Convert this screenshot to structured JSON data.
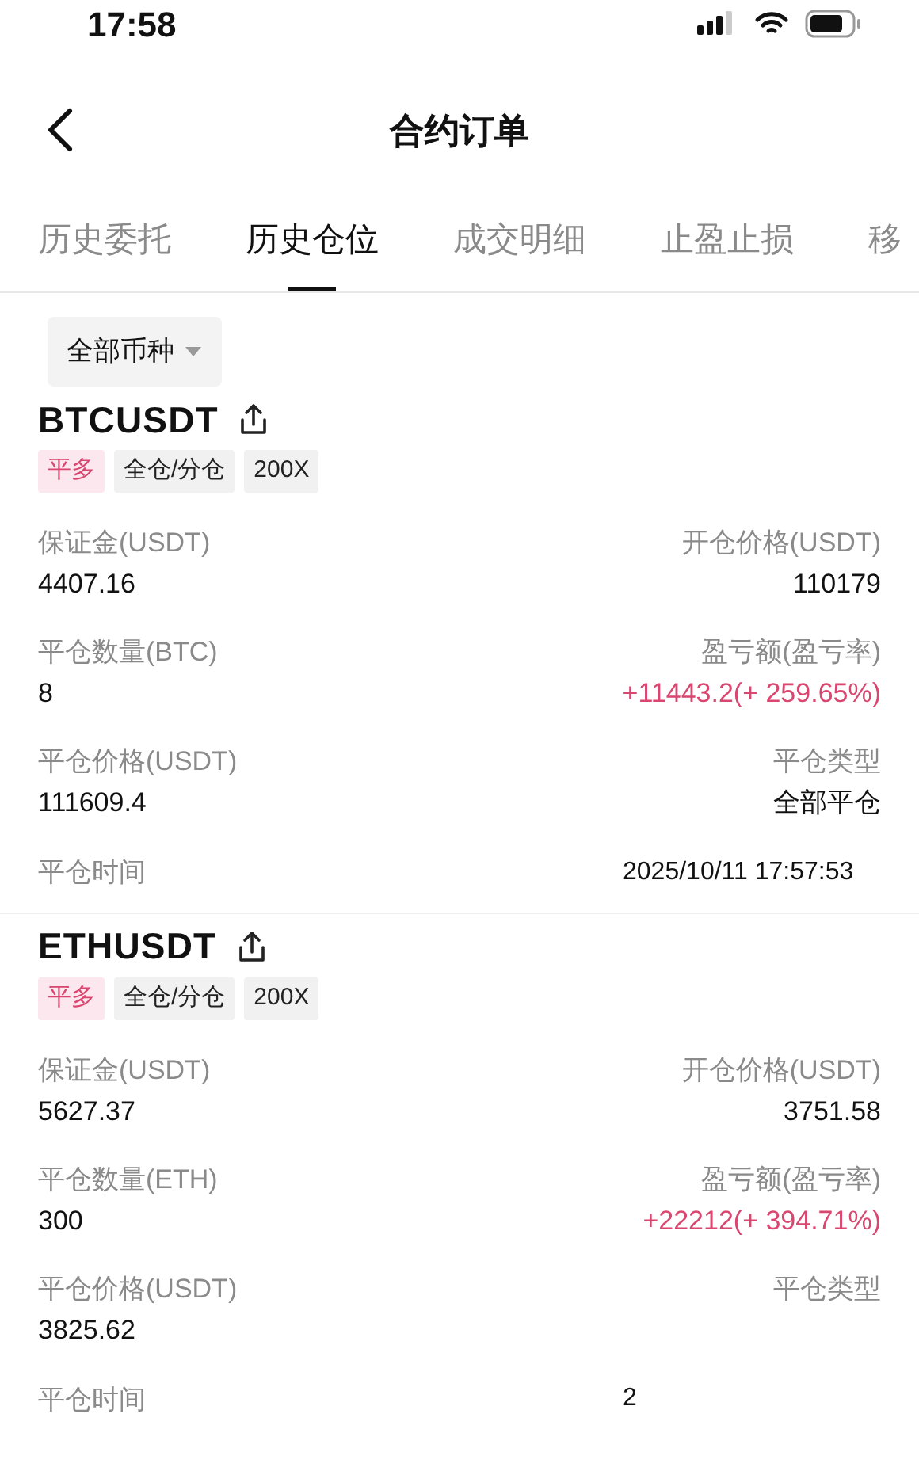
{
  "status_bar": {
    "time": "17:58"
  },
  "header": {
    "title": "合约订单"
  },
  "tabs": [
    {
      "label": "历史委托",
      "selected": false
    },
    {
      "label": "历史仓位",
      "selected": true
    },
    {
      "label": "成交明细",
      "selected": false
    },
    {
      "label": "止盈止损",
      "selected": false
    },
    {
      "label": "移",
      "selected": false
    }
  ],
  "filter": {
    "label": "全部币种"
  },
  "positions": [
    {
      "symbol": "BTCUSDT",
      "tags": [
        {
          "label": "平多",
          "kind": "side"
        },
        {
          "label": "全仓/分仓",
          "kind": "plain"
        },
        {
          "label": "200X",
          "kind": "plain"
        }
      ],
      "fields": [
        {
          "label": "保证金(USDT)",
          "value": "4407.16",
          "kind": "normal"
        },
        {
          "label": "开仓价格(USDT)",
          "value": "110179",
          "kind": "normal"
        },
        {
          "label": "平仓数量(BTC)",
          "value": "8",
          "kind": "normal"
        },
        {
          "label": "盈亏额(盈亏率)",
          "value": "+11443.2(+ 259.65%)",
          "kind": "profit"
        },
        {
          "label": "平仓价格(USDT)",
          "value": "111609.4",
          "kind": "normal"
        },
        {
          "label": "平仓类型",
          "value": "全部平仓",
          "kind": "normal"
        }
      ],
      "time_label": "平仓时间",
      "time": "2025/10/11 17:57:53"
    },
    {
      "symbol": "ETHUSDT",
      "tags": [
        {
          "label": "平多",
          "kind": "side"
        },
        {
          "label": "全仓/分仓",
          "kind": "plain"
        },
        {
          "label": "200X",
          "kind": "plain"
        }
      ],
      "fields": [
        {
          "label": "保证金(USDT)",
          "value": "5627.37",
          "kind": "normal"
        },
        {
          "label": "开仓价格(USDT)",
          "value": "3751.58",
          "kind": "normal"
        },
        {
          "label": "平仓数量(ETH)",
          "value": "300",
          "kind": "normal"
        },
        {
          "label": "盈亏额(盈亏率)",
          "value": "+22212(+ 394.71%)",
          "kind": "profit"
        },
        {
          "label": "平仓价格(USDT)",
          "value": "3825.62",
          "kind": "normal"
        },
        {
          "label": "平仓类型"
        }
      ],
      "time_label": "平仓时间",
      "time": "2"
    }
  ]
}
